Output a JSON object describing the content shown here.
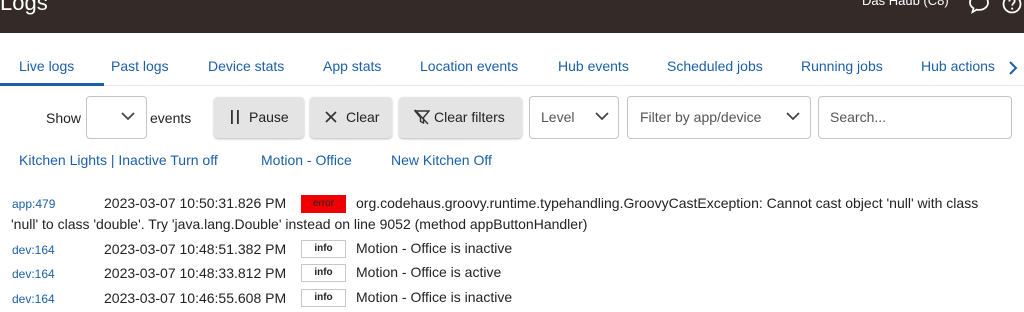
{
  "header": {
    "title": "Logs",
    "hub_name": "Das Haub (C8)",
    "icons": [
      "chat-icon",
      "help-icon"
    ]
  },
  "tabs": [
    {
      "label": "Live logs",
      "active": true
    },
    {
      "label": "Past logs"
    },
    {
      "label": "Device stats"
    },
    {
      "label": "App stats"
    },
    {
      "label": "Location events"
    },
    {
      "label": "Hub events"
    },
    {
      "label": "Scheduled jobs"
    },
    {
      "label": "Running jobs"
    },
    {
      "label": "Hub actions"
    }
  ],
  "controls": {
    "show_label": "Show",
    "events_label": "events",
    "show_value": "",
    "pause_label": "Pause",
    "clear_label": "Clear",
    "clear_filters_label": "Clear filters",
    "level_placeholder": "Level",
    "filter_placeholder": "Filter by app/device",
    "search_placeholder": "Search..."
  },
  "shortcuts": [
    "Kitchen Lights | Inactive Turn off",
    "Motion - Office",
    "New Kitchen Off"
  ],
  "logs": [
    {
      "source": "app:479",
      "time": "2023-03-07 10:50:31.826 PM",
      "level": "error",
      "message": "org.codehaus.groovy.runtime.typehandling.GroovyCastException: Cannot cast object 'null' with class 'null' to class 'double'. Try 'java.lang.Double' instead on line 9052 (method appButtonHandler)"
    },
    {
      "source": "dev:164",
      "time": "2023-03-07 10:48:51.382 PM",
      "level": "info",
      "message": "Motion - Office is inactive"
    },
    {
      "source": "dev:164",
      "time": "2023-03-07 10:48:33.812 PM",
      "level": "info",
      "message": "Motion - Office is active"
    },
    {
      "source": "dev:164",
      "time": "2023-03-07 10:46:55.608 PM",
      "level": "info",
      "message": "Motion - Office is inactive"
    }
  ],
  "colors": {
    "header_bg": "#342b28",
    "link": "#1b5fa8",
    "error_badge": "#f00000"
  }
}
